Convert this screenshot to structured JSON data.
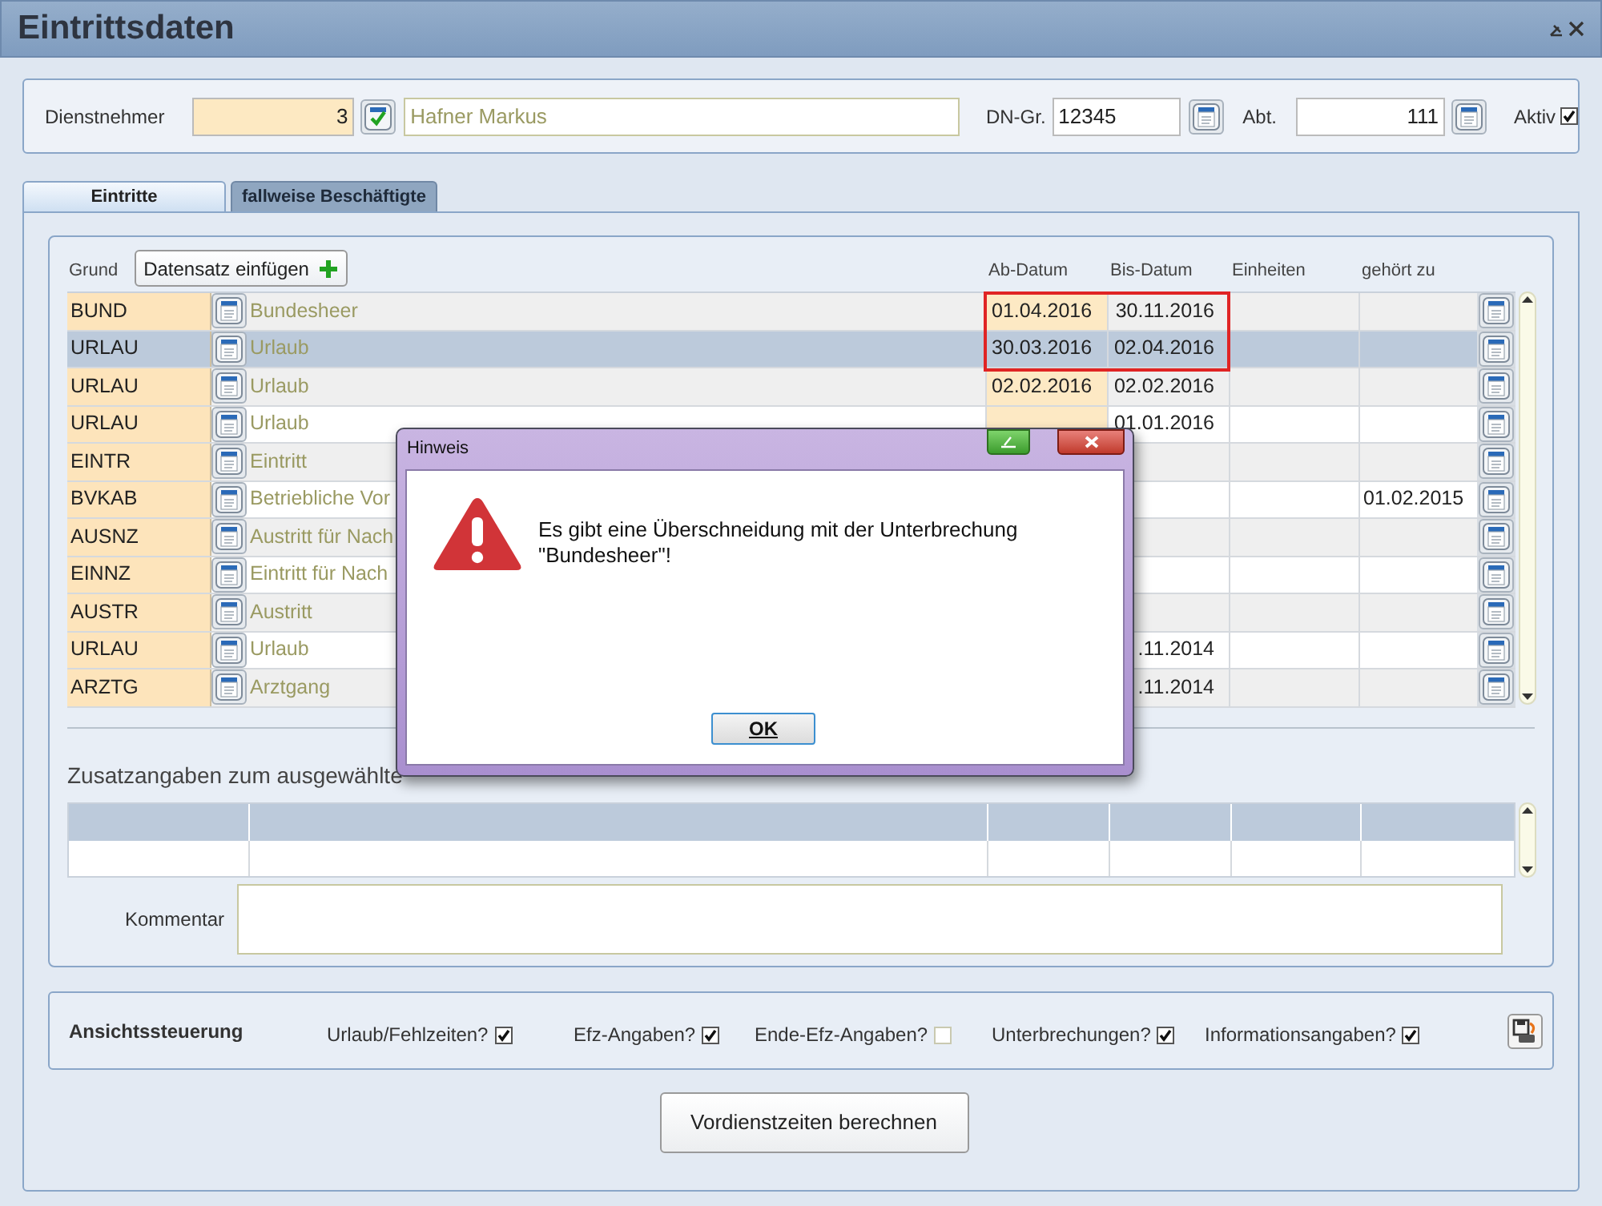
{
  "window": {
    "title": "Eintrittsdaten"
  },
  "employee": {
    "label": "Dienstnehmer",
    "number": "3",
    "name": "Hafner Markus",
    "group_label": "DN-Gr.",
    "group": "12345",
    "dept_label": "Abt.",
    "dept": "111",
    "active_label": "Aktiv",
    "active": true
  },
  "tabs": [
    {
      "label": "Eintritte",
      "selected": true
    },
    {
      "label": "fallweise Beschäftigte",
      "selected": false
    }
  ],
  "entries": {
    "grund_label": "Grund",
    "insert_button": "Datensatz einfügen",
    "columns": [
      "Ab-Datum",
      "Bis-Datum",
      "Einheiten",
      "gehört zu"
    ],
    "rows": [
      {
        "code": "BUND",
        "description": "Bundesheer",
        "from": "01.04.2016",
        "to": "30.11.2016",
        "selected": false,
        "flagged": true
      },
      {
        "code": "URLAU",
        "description": "Urlaub",
        "from": "30.03.2016",
        "to": "02.04.2016",
        "selected": true,
        "flagged": true
      },
      {
        "code": "URLAU",
        "description": "Urlaub",
        "from": "02.02.2016",
        "to": "02.02.2016",
        "selected": false,
        "flagged": false
      },
      {
        "code": "URLAU",
        "description": "Urlaub",
        "to": "01.01.2016",
        "selected": false,
        "flagged": false
      },
      {
        "code": "EINTR",
        "description": "Eintritt",
        "selected": false,
        "flagged": false
      },
      {
        "code": "BVKAB",
        "description": "Betriebliche Vor",
        "belongs_to": "01.02.2015",
        "selected": false,
        "flagged": false
      },
      {
        "code": "AUSNZ",
        "description": "Austritt für Nach",
        "selected": false,
        "flagged": false
      },
      {
        "code": "EINNZ",
        "description": "Eintritt für Nach",
        "selected": false,
        "flagged": false
      },
      {
        "code": "AUSTR",
        "description": "Austritt",
        "selected": false,
        "flagged": false
      },
      {
        "code": "URLAU",
        "description": "Urlaub",
        "to": ".11.2014",
        "selected": false,
        "flagged": false
      },
      {
        "code": "ARZTG",
        "description": "Arztgang",
        "to": ".11.2014",
        "selected": false,
        "flagged": false
      }
    ]
  },
  "details": {
    "title": "Zusatzangaben zum ausgewählte",
    "comment_label": "Kommentar"
  },
  "view_control": {
    "title": "Ansichtssteuerung",
    "options": [
      {
        "label": "Urlaub/Fehlzeiten?",
        "checked": true
      },
      {
        "label": "Efz-Angaben?",
        "checked": true
      },
      {
        "label": "Ende-Efz-Angaben?",
        "checked": false
      },
      {
        "label": "Unterbrechungen?",
        "checked": true
      },
      {
        "label": "Informationsangaben?",
        "checked": true
      }
    ]
  },
  "calc_button": "Vordienstzeiten berechnen",
  "dialog": {
    "title": "Hinweis",
    "message": "Es gibt eine Überschneidung mit der Unterbrechung \"Bundesheer\"!",
    "button": "OK"
  }
}
